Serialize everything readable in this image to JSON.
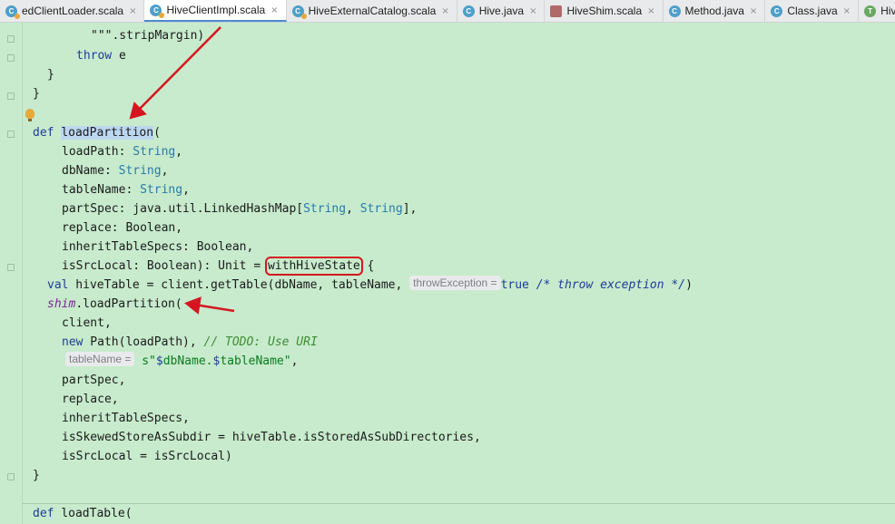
{
  "tabs": [
    {
      "label": "edClientLoader.scala",
      "icon": "scala-class-icon",
      "active": false
    },
    {
      "label": "HiveClientImpl.scala",
      "icon": "scala-class-icon",
      "active": true
    },
    {
      "label": "HiveExternalCatalog.scala",
      "icon": "scala-class-icon",
      "active": false
    },
    {
      "label": "Hive.java",
      "icon": "java-class-icon",
      "active": false
    },
    {
      "label": "HiveShim.scala",
      "icon": "scala-file-icon",
      "active": false
    },
    {
      "label": "Method.java",
      "icon": "java-class-icon",
      "active": false
    },
    {
      "label": "Class.java",
      "icon": "java-class-icon",
      "active": false
    },
    {
      "label": "HiveCl",
      "icon": "trait-icon",
      "active": false
    }
  ],
  "tab_close_glyph": "×",
  "code": {
    "l1": "\"\"\".stripMargin)",
    "l2_kw": "throw",
    "l2_rest": " e",
    "brace_close": "}",
    "def_kw": "def",
    "fn_load_partition": "loadPartition",
    "open_paren": "(",
    "p_loadpath": "loadPath: ",
    "p_dbname": "dbName: ",
    "p_tablename": "tableName: ",
    "t_string": "String",
    "comma": ",",
    "p_partspec_a": "partSpec: java.util.LinkedHashMap[",
    "p_partspec_b": ", ",
    "p_partspec_c": "],",
    "p_replace": "replace: Boolean,",
    "p_inherit": "inheritTableSpecs: Boolean,",
    "p_srclocal_a": "isSrcLocal: Boolean): Unit = ",
    "with_hive_state": "withHiveState",
    "p_srclocal_b": " {",
    "val_kw": "val",
    "val_rest": " hiveTable = client.getTable(dbName, tableName, ",
    "hint_throw": "throwException =",
    "true_kw": "true",
    "throw_comment": "/* throw exception */",
    "close_paren": ")",
    "shim_field": "shim",
    "shim_rest": ".loadPartition(",
    "a_client": "client,",
    "new_kw": "new",
    "a_path": " Path(loadPath), ",
    "todo_comment": "// TODO: Use URI",
    "hint_tablename": "tableName =",
    "s_interp_a": "s\"",
    "s_interp_b": "$",
    "s_interp_c": "dbName.",
    "s_interp_d": "$",
    "s_interp_e": "tableName\"",
    "a_partspec": "partSpec,",
    "a_replace": "replace,",
    "a_inherit": "inheritTableSpecs,",
    "a_skewed": "isSkewedStoreAsSubdir = hiveTable.isStoredAsSubDirectories,",
    "a_srclocal": "isSrcLocal = isSrcLocal)",
    "fn_load_table": "loadTable",
    "fn_load_table_paren": "("
  },
  "colors": {
    "editor_bg": "#c7ebcc",
    "annotation_red": "#d5151f",
    "keyword": "#1f3b9a",
    "type": "#2a7aa8",
    "comment": "#3f8c35"
  }
}
